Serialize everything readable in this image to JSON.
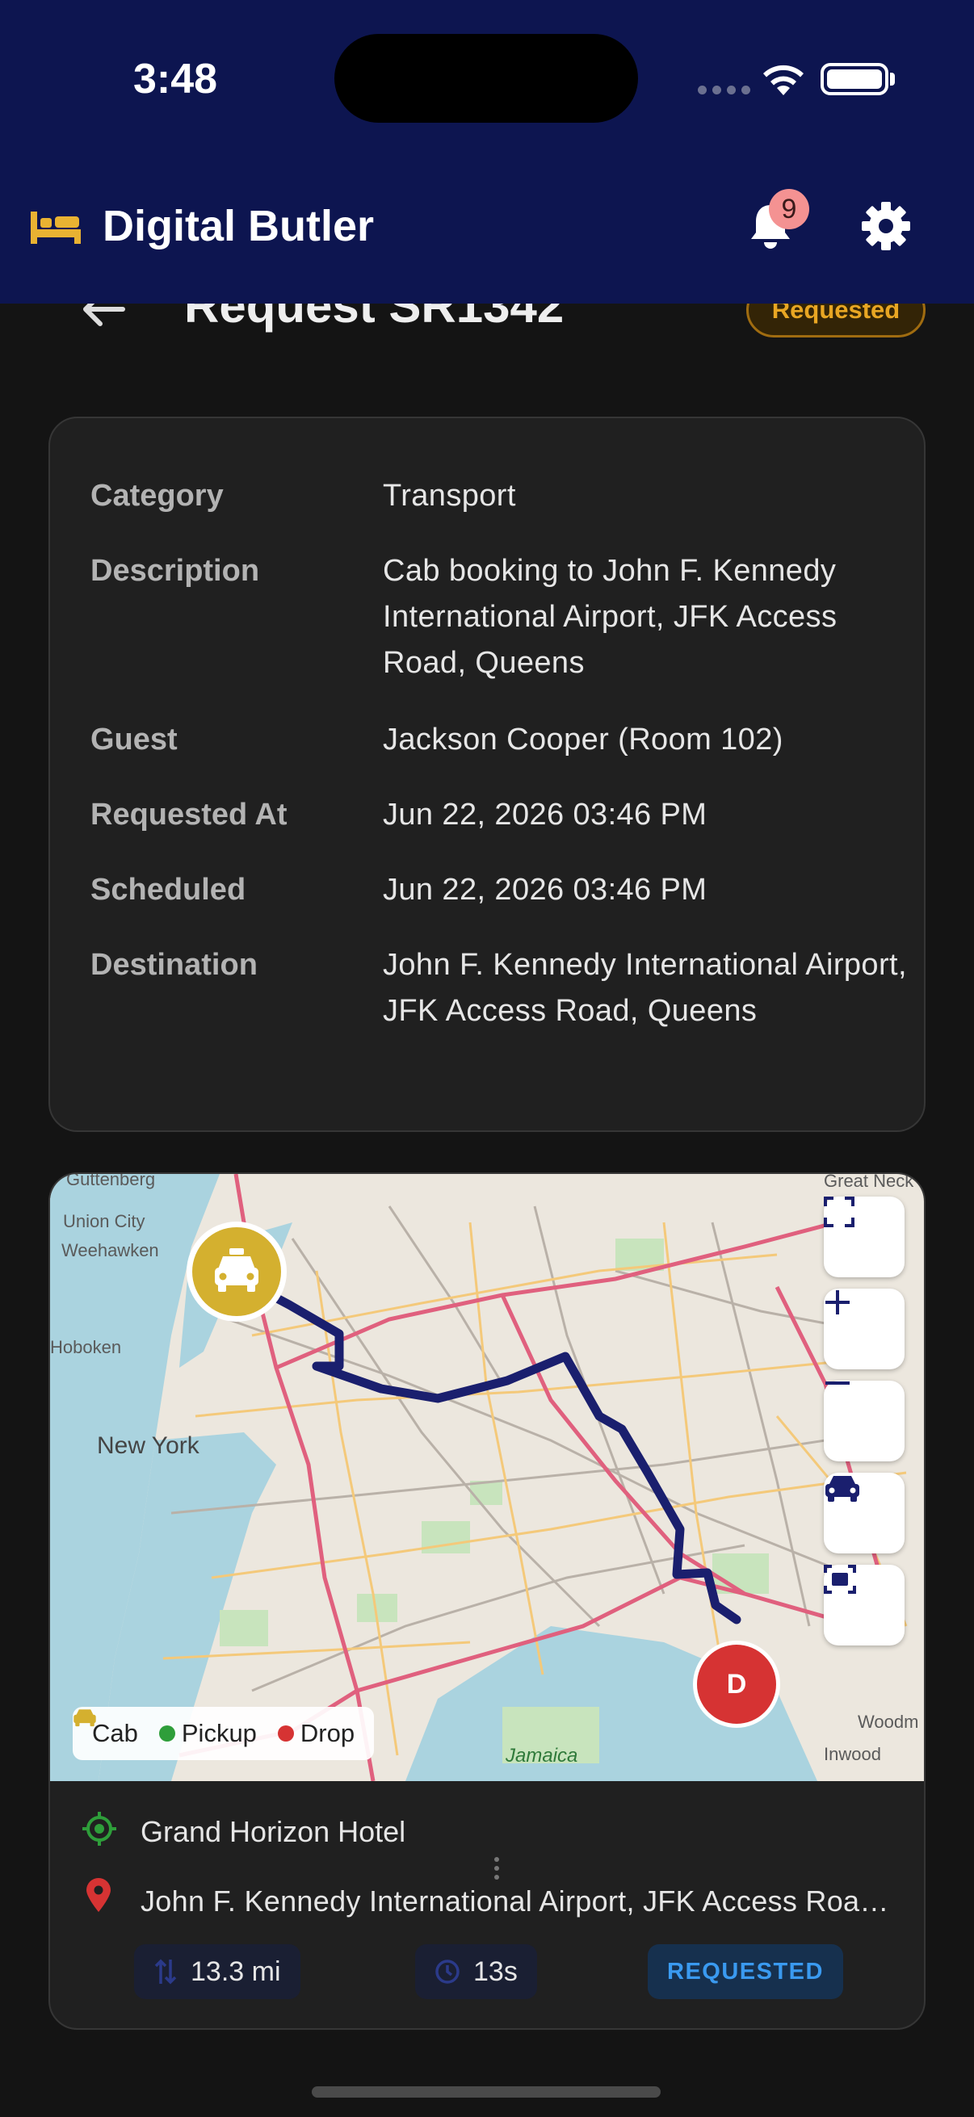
{
  "status_bar": {
    "time": "3:48"
  },
  "app_bar": {
    "title": "Digital Butler",
    "notification_count": "9",
    "icons": [
      "bed-icon",
      "bell-icon",
      "gear-icon"
    ]
  },
  "header": {
    "title": "Request SR1342",
    "status": "Requested"
  },
  "details": {
    "rows": [
      {
        "label": "Category",
        "value": "Transport"
      },
      {
        "label": "Description",
        "value": "Cab booking to John F. Kennedy International Airport, JFK Access Road, Queens"
      },
      {
        "label": "Guest",
        "value": "Jackson Cooper (Room 102)"
      },
      {
        "label": "Requested At",
        "value": "Jun 22, 2026 03:46 PM"
      },
      {
        "label": "Scheduled",
        "value": "Jun 22, 2026 03:46 PM"
      },
      {
        "label": "Destination",
        "value": "John F. Kennedy International Airport, JFK Access Road, Queens"
      }
    ]
  },
  "map": {
    "place_labels": [
      "Guttenberg",
      "Union City",
      "Weehawken",
      "Hoboken",
      "New York",
      "Great Neck",
      "Jamaica",
      "Inwood",
      "Woodm"
    ],
    "drop_marker": "D",
    "legend": {
      "cab": "Cab",
      "pickup": "Pickup",
      "drop": "Drop"
    },
    "colors": {
      "cab": "#d4b02f",
      "pickup": "#2e9e3a",
      "drop": "#d63333",
      "route": "#1a1f6e"
    }
  },
  "route": {
    "from": "Grand Horizon Hotel",
    "to": "John F. Kennedy International Airport, JFK Access Road, Queens",
    "distance": "13.3 mi",
    "eta": "13s",
    "status": "REQUESTED"
  }
}
